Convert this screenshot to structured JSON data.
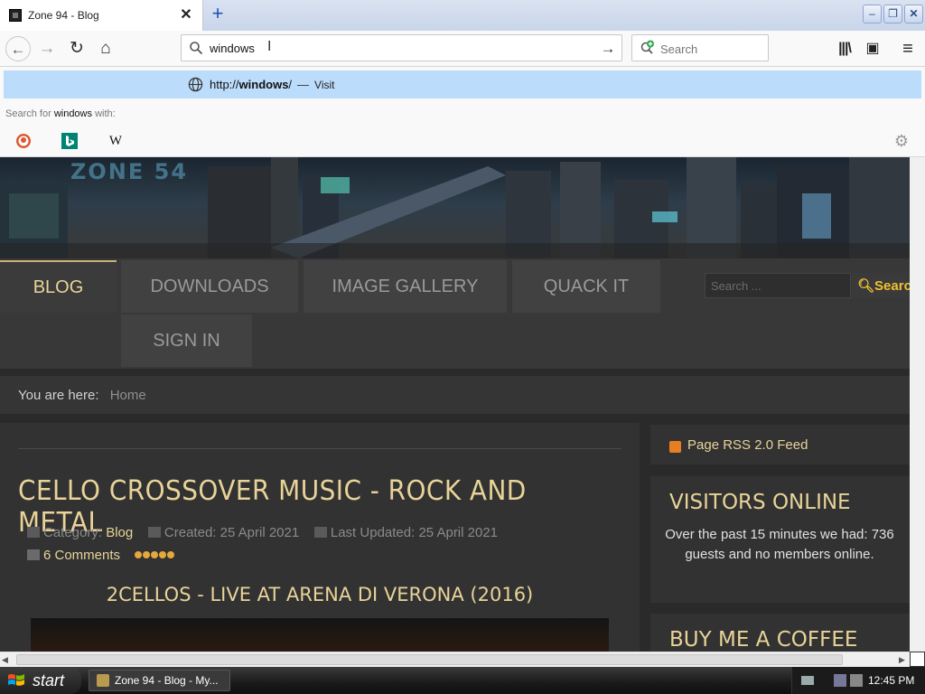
{
  "browser": {
    "tab": {
      "title": "Zone 94 - Blog",
      "close": "✕"
    },
    "new_tab": "+",
    "window_controls": {
      "minimize": "–",
      "maximize": "❐",
      "close": "✕"
    },
    "nav": {
      "back": "←",
      "forward": "→",
      "reload": "↻",
      "home": "⌂"
    },
    "urlbar": {
      "value": "windows",
      "go": "→"
    },
    "searchbar": {
      "placeholder": "Search"
    },
    "toolbar": {
      "library": "|||\\",
      "sidebar": "▣",
      "menu": "≡"
    }
  },
  "url_popup": {
    "suggestion": {
      "scheme": "http://",
      "host": "windows",
      "path": "/",
      "dash": "—",
      "action": "Visit"
    },
    "search_for": {
      "prefix": "Search for",
      "term": "windows",
      "suffix": "with:"
    },
    "engines": {
      "wikipedia": "W"
    },
    "gear": "⚙"
  },
  "page": {
    "logo": "ZONE 54",
    "menu": {
      "blog": "BLOG",
      "downloads": "DOWNLOADS",
      "gallery": "IMAGE GALLERY",
      "quack": "QUACK IT",
      "signin": "SIGN IN"
    },
    "search": {
      "placeholder": "Search ...",
      "button": "Search"
    },
    "breadcrumb": {
      "label": "You are here:",
      "home": "Home"
    },
    "article": {
      "title": "CELLO CROSSOVER MUSIC - ROCK AND METAL",
      "category_label": "Category:",
      "category": "Blog",
      "created": "Created: 25 April 2021",
      "updated": "Last Updated: 25 April 2021",
      "comments": "6 Comments",
      "subtitle": "2CELLOS - LIVE AT ARENA DI VERONA (2016)"
    },
    "sidebar": {
      "rss": "Page RSS 2.0 Feed",
      "visitors_title": "VISITORS ONLINE",
      "visitors_text": "Over the past 15 minutes we had: 736 guests and no members online.",
      "coffee_title": "BUY ME A COFFEE"
    }
  },
  "taskbar": {
    "start": "start",
    "task": "Zone 94 - Blog - My...",
    "clock": "12:45 PM"
  },
  "colors": {
    "accent": "#e8d398",
    "menu_bg": "#414141",
    "suggest_bg": "#bcdcfb"
  }
}
